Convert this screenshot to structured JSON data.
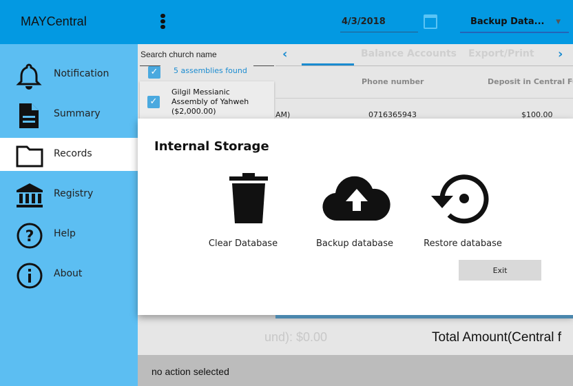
{
  "header": {
    "title": "MAYCentral",
    "date": "4/3/2018",
    "action_select": "Backup Data...",
    "icons": [
      "menu-vertical-icon",
      "calendar-icon",
      "dropdown-arrow-icon"
    ]
  },
  "sidebar": {
    "items": [
      {
        "label": "Notification",
        "icon": "bell-icon"
      },
      {
        "label": "Summary",
        "icon": "document-icon"
      },
      {
        "label": "Records",
        "icon": "folder-icon",
        "active": true
      },
      {
        "label": "Registry",
        "icon": "bank-icon"
      },
      {
        "label": "Help",
        "icon": "help-icon"
      },
      {
        "label": "About",
        "icon": "info-icon"
      }
    ]
  },
  "search": {
    "placeholder": "Search church name",
    "found": "5 assemblies found",
    "items": [
      {
        "name": "Gilgil Messianic Assembly of Yahweh ($2,000.00)",
        "checked": true
      }
    ]
  },
  "tabs": {
    "items": [
      "Balance Accounts",
      "Export/Print"
    ]
  },
  "table": {
    "headers": [
      "Phone number",
      "Deposit in Central Fu"
    ],
    "rows": [
      {
        "partial": "AM)",
        "phone": "0716365943",
        "deposit": "$100.00"
      }
    ]
  },
  "modal": {
    "title": "Internal Storage",
    "actions": [
      {
        "label": "Clear Database",
        "icon": "trash-icon"
      },
      {
        "label": "Backup database",
        "icon": "cloud-upload-icon"
      },
      {
        "label": "Restore database",
        "icon": "restore-icon"
      }
    ],
    "exit": "Exit"
  },
  "footer": {
    "fund_total": "und): $0.00",
    "total_amount": "Total Amount(Central f",
    "status": "no action selected"
  },
  "colors": {
    "header": "#0399e2",
    "sidebar": "#5cbef2",
    "accent": "#1a8bd0"
  }
}
